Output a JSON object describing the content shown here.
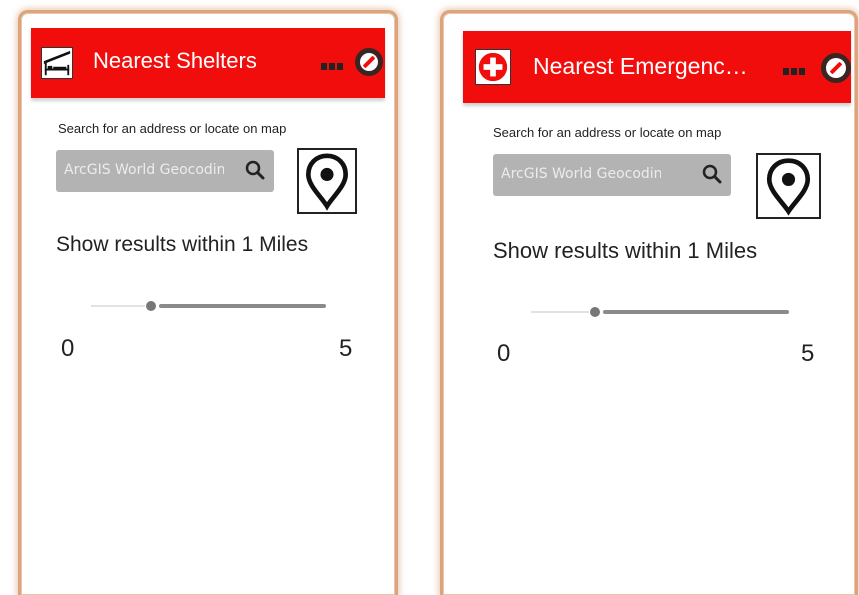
{
  "panels": [
    {
      "title": "Nearest Shelters",
      "header_icon": "shelter-icon",
      "search_label": "Search for an address or locate on map",
      "search_placeholder": "ArcGIS World Geocodin",
      "results_text": "Show results within 1 Miles",
      "slider": {
        "min": "0",
        "max": "5",
        "value": 1
      }
    },
    {
      "title": "Nearest Emergenc…",
      "header_icon": "emergency-cross-icon",
      "search_label": "Search for an address or locate on map",
      "search_placeholder": "ArcGIS World Geocodin",
      "results_text": "Show results within 1 Miles",
      "slider": {
        "min": "0",
        "max": "5",
        "value": 1
      }
    }
  ],
  "colors": {
    "header": "#f20d0d",
    "frame": "#d9a47e"
  }
}
